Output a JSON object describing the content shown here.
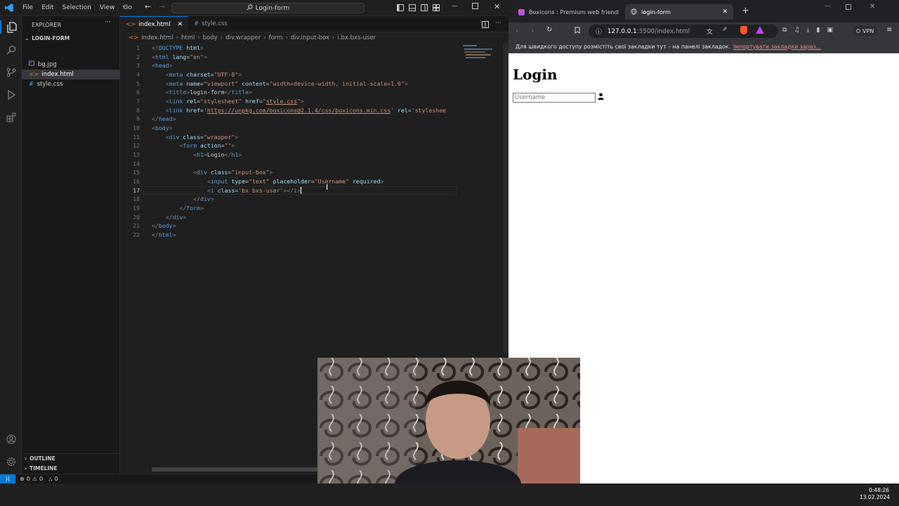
{
  "vscode": {
    "menu": [
      "File",
      "Edit",
      "Selection",
      "View",
      "Go"
    ],
    "command_center": "Login-form",
    "explorer_title": "EXPLORER",
    "folder": "LOGIN-FORM",
    "files": [
      "bg.jpg",
      "index.html",
      "style.css"
    ],
    "outline": "OUTLINE",
    "timeline": "TIMELINE",
    "tabs": [
      "index.html",
      "style.css"
    ],
    "breadcrumb": [
      "index.html",
      "html",
      "body",
      "div.wrapper",
      "form",
      "div.input-box",
      "i.bx.bxs-user"
    ],
    "line_numbers": [
      "1",
      "2",
      "3",
      "4",
      "5",
      "6",
      "7",
      "8",
      "9",
      "10",
      "11",
      "12",
      "13",
      "14",
      "15",
      "16",
      "17",
      "18",
      "19",
      "20",
      "21",
      "22"
    ],
    "status": {
      "errors": "0",
      "warnings": "0",
      "ports": "0"
    }
  },
  "browser": {
    "tabs": [
      "Boxicons : Premium web friendly ico",
      "login-form"
    ],
    "url_host": "127.0.0.1",
    "url_path": ":5500/index.html",
    "vpn": "VPN",
    "bookmark_bar_text": "Для швидкого доступу розмістіть свої закладки тут – на панелі закладок.",
    "bookmark_bar_link": "Імпортувати закладки зараз...",
    "page": {
      "heading": "Login",
      "input_placeholder": "Username"
    }
  },
  "taskbar": {
    "time": "0:48:26",
    "date": "13.02.2024"
  },
  "colors": {
    "accent": "#0078d4",
    "tag": "#569cd6",
    "attr": "#9cdcfe",
    "string": "#ce9178"
  }
}
